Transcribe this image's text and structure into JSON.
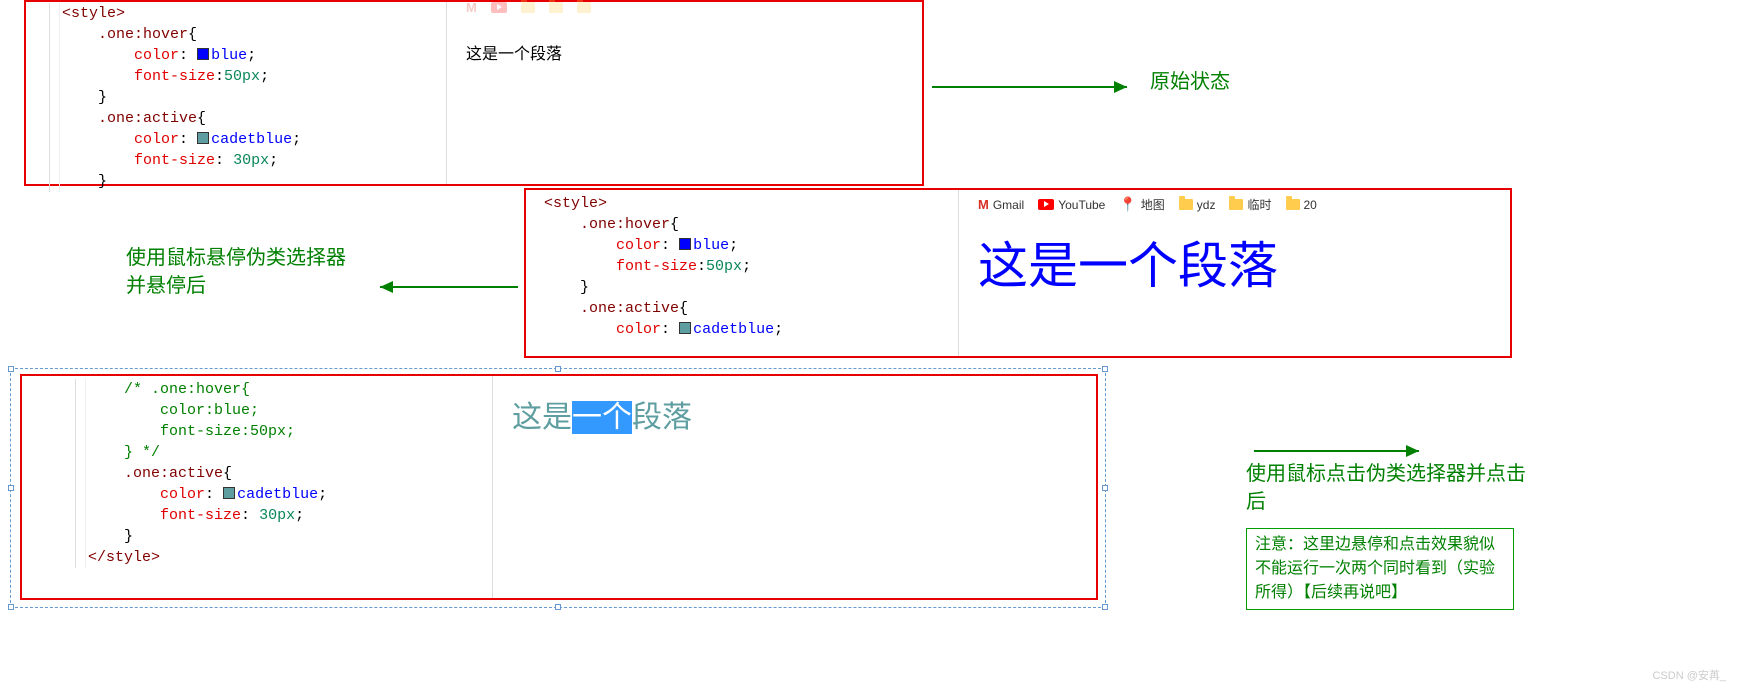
{
  "annotations": {
    "original_state": "原始状态",
    "hover_label_line1": "使用鼠标悬停伪类选择器",
    "hover_label_line2": "并悬停后",
    "active_label_line1": "使用鼠标点击伪类选择器并点击",
    "active_label_line2": "后",
    "note_line1": "注意：这里边悬停和点击效果貌似",
    "note_line2": "不能运行一次两个同时看到（实验",
    "note_line3": "所得）【后续再说吧】"
  },
  "bookmarks": {
    "gmail": "Gmail",
    "youtube": "YouTube",
    "map": "地图",
    "ydz": "ydz",
    "temp": "临时",
    "twenty": "20"
  },
  "render": {
    "panel1_text": "这是一个段落",
    "panel2_text": "这是一个段落",
    "panel3_pre": "这是",
    "panel3_sel": "一个",
    "panel3_post": "段落"
  },
  "code": {
    "style_open": "<style>",
    "style_close": "</style>",
    "hover_sel": ".one:hover",
    "active_sel": ".one:active",
    "brace_open": "{",
    "brace_close": "}",
    "prop_color": "color",
    "prop_fontsize": "font-size",
    "val_blue": "blue",
    "val_cadet": "cadetblue",
    "val_50px": "50px",
    "val_30px": "30px",
    "colon": ":",
    "semicolon": ";",
    "comment_open": "/* ",
    "comment_hover": ".one:hover{",
    "comment_color": "    color:blue;",
    "comment_fs": "    font-size:50px;",
    "comment_close": "} */"
  },
  "watermark": "CSDN @安苒_",
  "colors": {
    "red_border": "#e60000",
    "green_text": "#008000",
    "blue_text": "#0000ff",
    "cadet": "#5f9ea0"
  }
}
